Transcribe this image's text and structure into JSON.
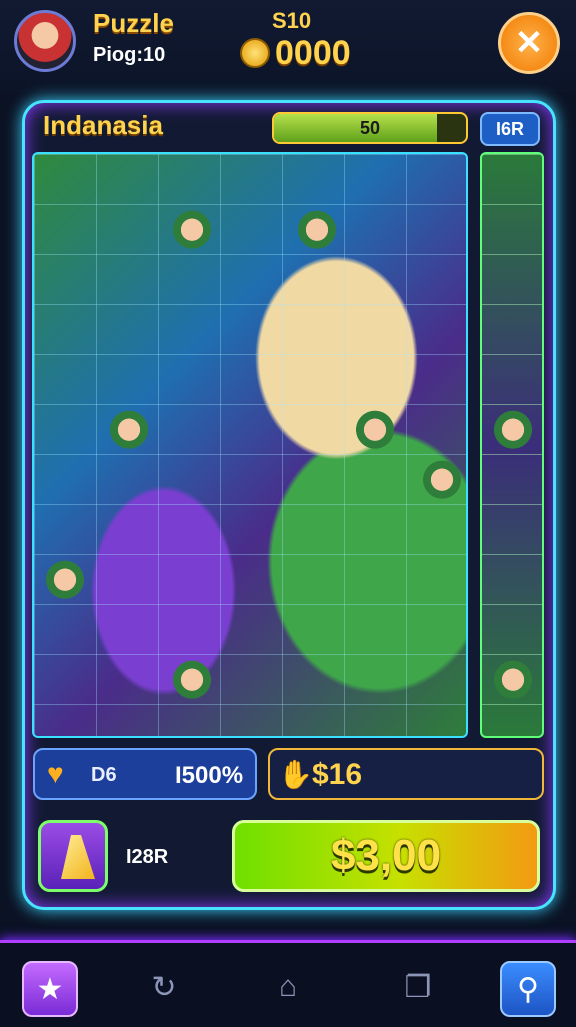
{
  "header": {
    "title": "Puzzle",
    "level": "Piog:10",
    "coin_label": "S10",
    "coin_count": "0000",
    "close_icon": "close-icon"
  },
  "board": {
    "region_name": "Indanasia",
    "progress_text": "50",
    "progress_fraction": 0.85,
    "tag": "I6R"
  },
  "stats": {
    "lives_label": "D6",
    "lives_value": "I500%",
    "hint_value": "$16"
  },
  "actions": {
    "power_label": "I28R",
    "buy_label": "$3,00"
  },
  "nav": {
    "items": [
      "star-icon",
      "refresh-icon",
      "home-icon",
      "layers-icon",
      "search-icon"
    ]
  },
  "colors": {
    "accent": "#47e3ff",
    "gold": "#ffd34d",
    "nav_accent": "#b040ff"
  }
}
